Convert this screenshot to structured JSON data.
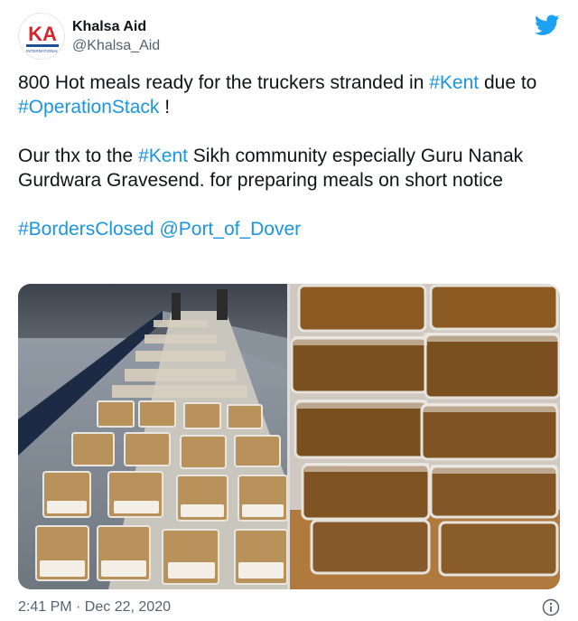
{
  "account": {
    "display_name": "Khalsa Aid",
    "handle": "@Khalsa_Aid",
    "avatar_text": "KA",
    "avatar_subtext": "INTERNATIONAL"
  },
  "tweet": {
    "line1": [
      {
        "text": "800 Hot meals ready for the truckers stranded in ",
        "type": "text"
      },
      {
        "text": "#Kent",
        "type": "hashtag"
      },
      {
        "text": " due to ",
        "type": "text"
      },
      {
        "text": "#OperationStack",
        "type": "hashtag"
      },
      {
        "text": "  !",
        "type": "text"
      }
    ],
    "line2": [
      {
        "text": "Our thx to the ",
        "type": "text"
      },
      {
        "text": "#Kent",
        "type": "hashtag"
      },
      {
        "text": " Sikh community especially Guru Nanak Gurdwara Gravesend. for preparing meals on short notice",
        "type": "text"
      }
    ],
    "line3": [
      {
        "text": "#BordersClosed",
        "type": "hashtag"
      },
      {
        "text": " ",
        "type": "text"
      },
      {
        "text": "@Port_of_Dover",
        "type": "mention"
      }
    ]
  },
  "timestamp": "2:41 PM · Dec 22, 2020",
  "icons": {
    "brand": "twitter-bird-icon",
    "info": "info-icon"
  },
  "colors": {
    "link": "#1b95e0",
    "twitter_blue": "#1da1f2",
    "secondary_text": "#536471",
    "avatar_red": "#d9232d",
    "avatar_blue": "#1f4e9a"
  }
}
